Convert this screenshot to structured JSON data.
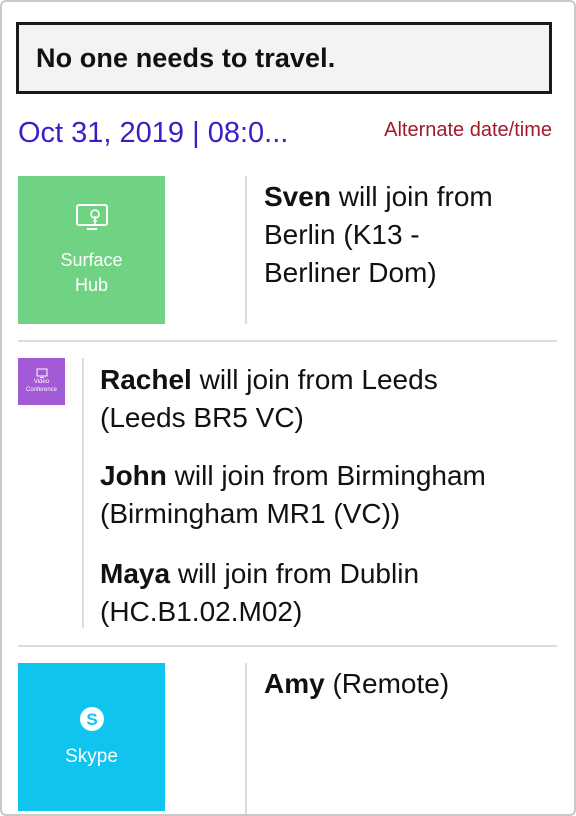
{
  "headline": "No one needs to travel.",
  "meeting": {
    "date_time": "Oct 31, 2019 | 08:0...",
    "alternate_link": "Alternate date/time"
  },
  "groups": [
    {
      "tile": {
        "label_line1": "Surface",
        "label_line2": "Hub",
        "icon": "surface-hub-icon",
        "color": "#70d384"
      },
      "attendees": [
        {
          "name": "Sven",
          "text_line1": " will join from",
          "text_line2": "Berlin (K13 -",
          "text_line3": "Berliner Dom)"
        }
      ]
    },
    {
      "tile": {
        "label_line1": "Video",
        "label_line2": "Conference",
        "icon": "video-conference-icon",
        "color": "#a25ad6"
      },
      "attendees": [
        {
          "name": "Rachel",
          "text_line1": " will join from Leeds",
          "text_line2": "(Leeds BR5 VC)"
        },
        {
          "name": "John",
          "text_line1": " will join from Birmingham",
          "text_line2": "(Birmingham MR1 (VC))"
        },
        {
          "name": "Maya",
          "text_line1": " will join from Dublin",
          "text_line2": "(HC.B1.02.M02)"
        }
      ]
    },
    {
      "tile": {
        "label_line1": "Skype",
        "icon": "skype-icon",
        "color": "#0fc4ef"
      },
      "attendees": [
        {
          "name": "Amy",
          "text_line1": " (Remote)"
        }
      ]
    }
  ]
}
